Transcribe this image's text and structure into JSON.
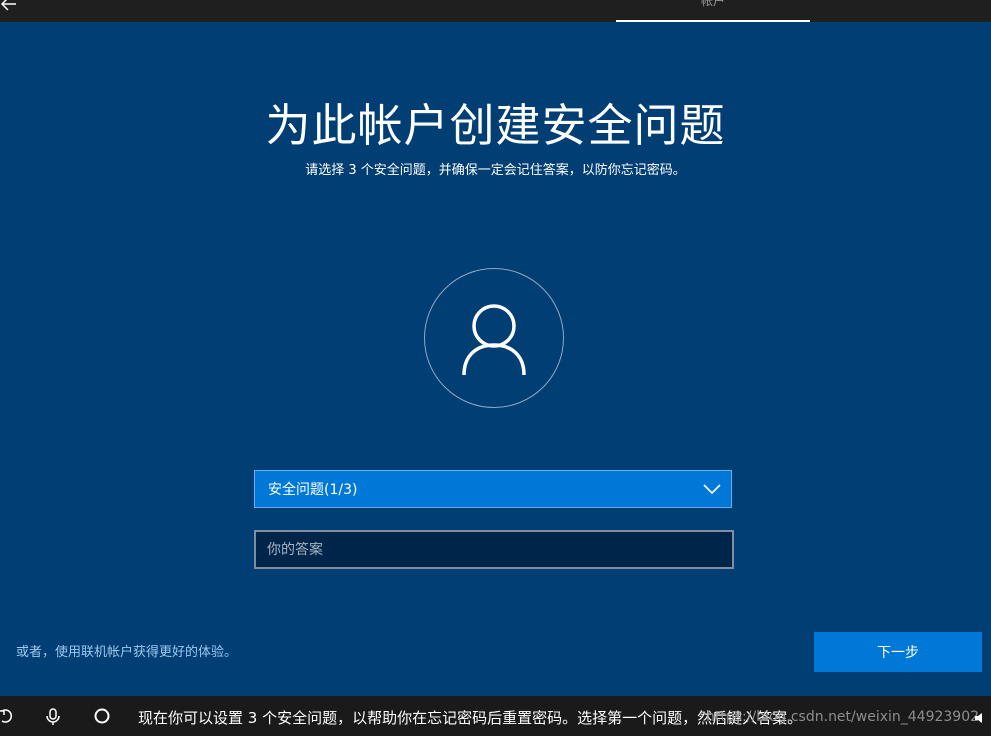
{
  "topbar": {
    "tab_label": "帐户"
  },
  "title": "为此帐户创建安全问题",
  "subtitle": "请选择 3 个安全问题，并确保一定会记住答案，以防你忘记密码。",
  "security_question": {
    "selected": "安全问题(1/3)"
  },
  "answer": {
    "placeholder": "你的答案",
    "value": ""
  },
  "alt_link": "或者，使用联机帐户获得更好的体验。",
  "next_button": "下一步",
  "taskbar": {
    "narration": "现在你可以设置 3 个安全问题，以帮助你在忘记密码后重置密码。选择第一个问题，然后键入答案。",
    "watermark": "https://blog.csdn.net/weixin_44923902"
  },
  "colors": {
    "background": "#003e74",
    "accent": "#0078d7",
    "taskbar": "#1a1a1a"
  }
}
